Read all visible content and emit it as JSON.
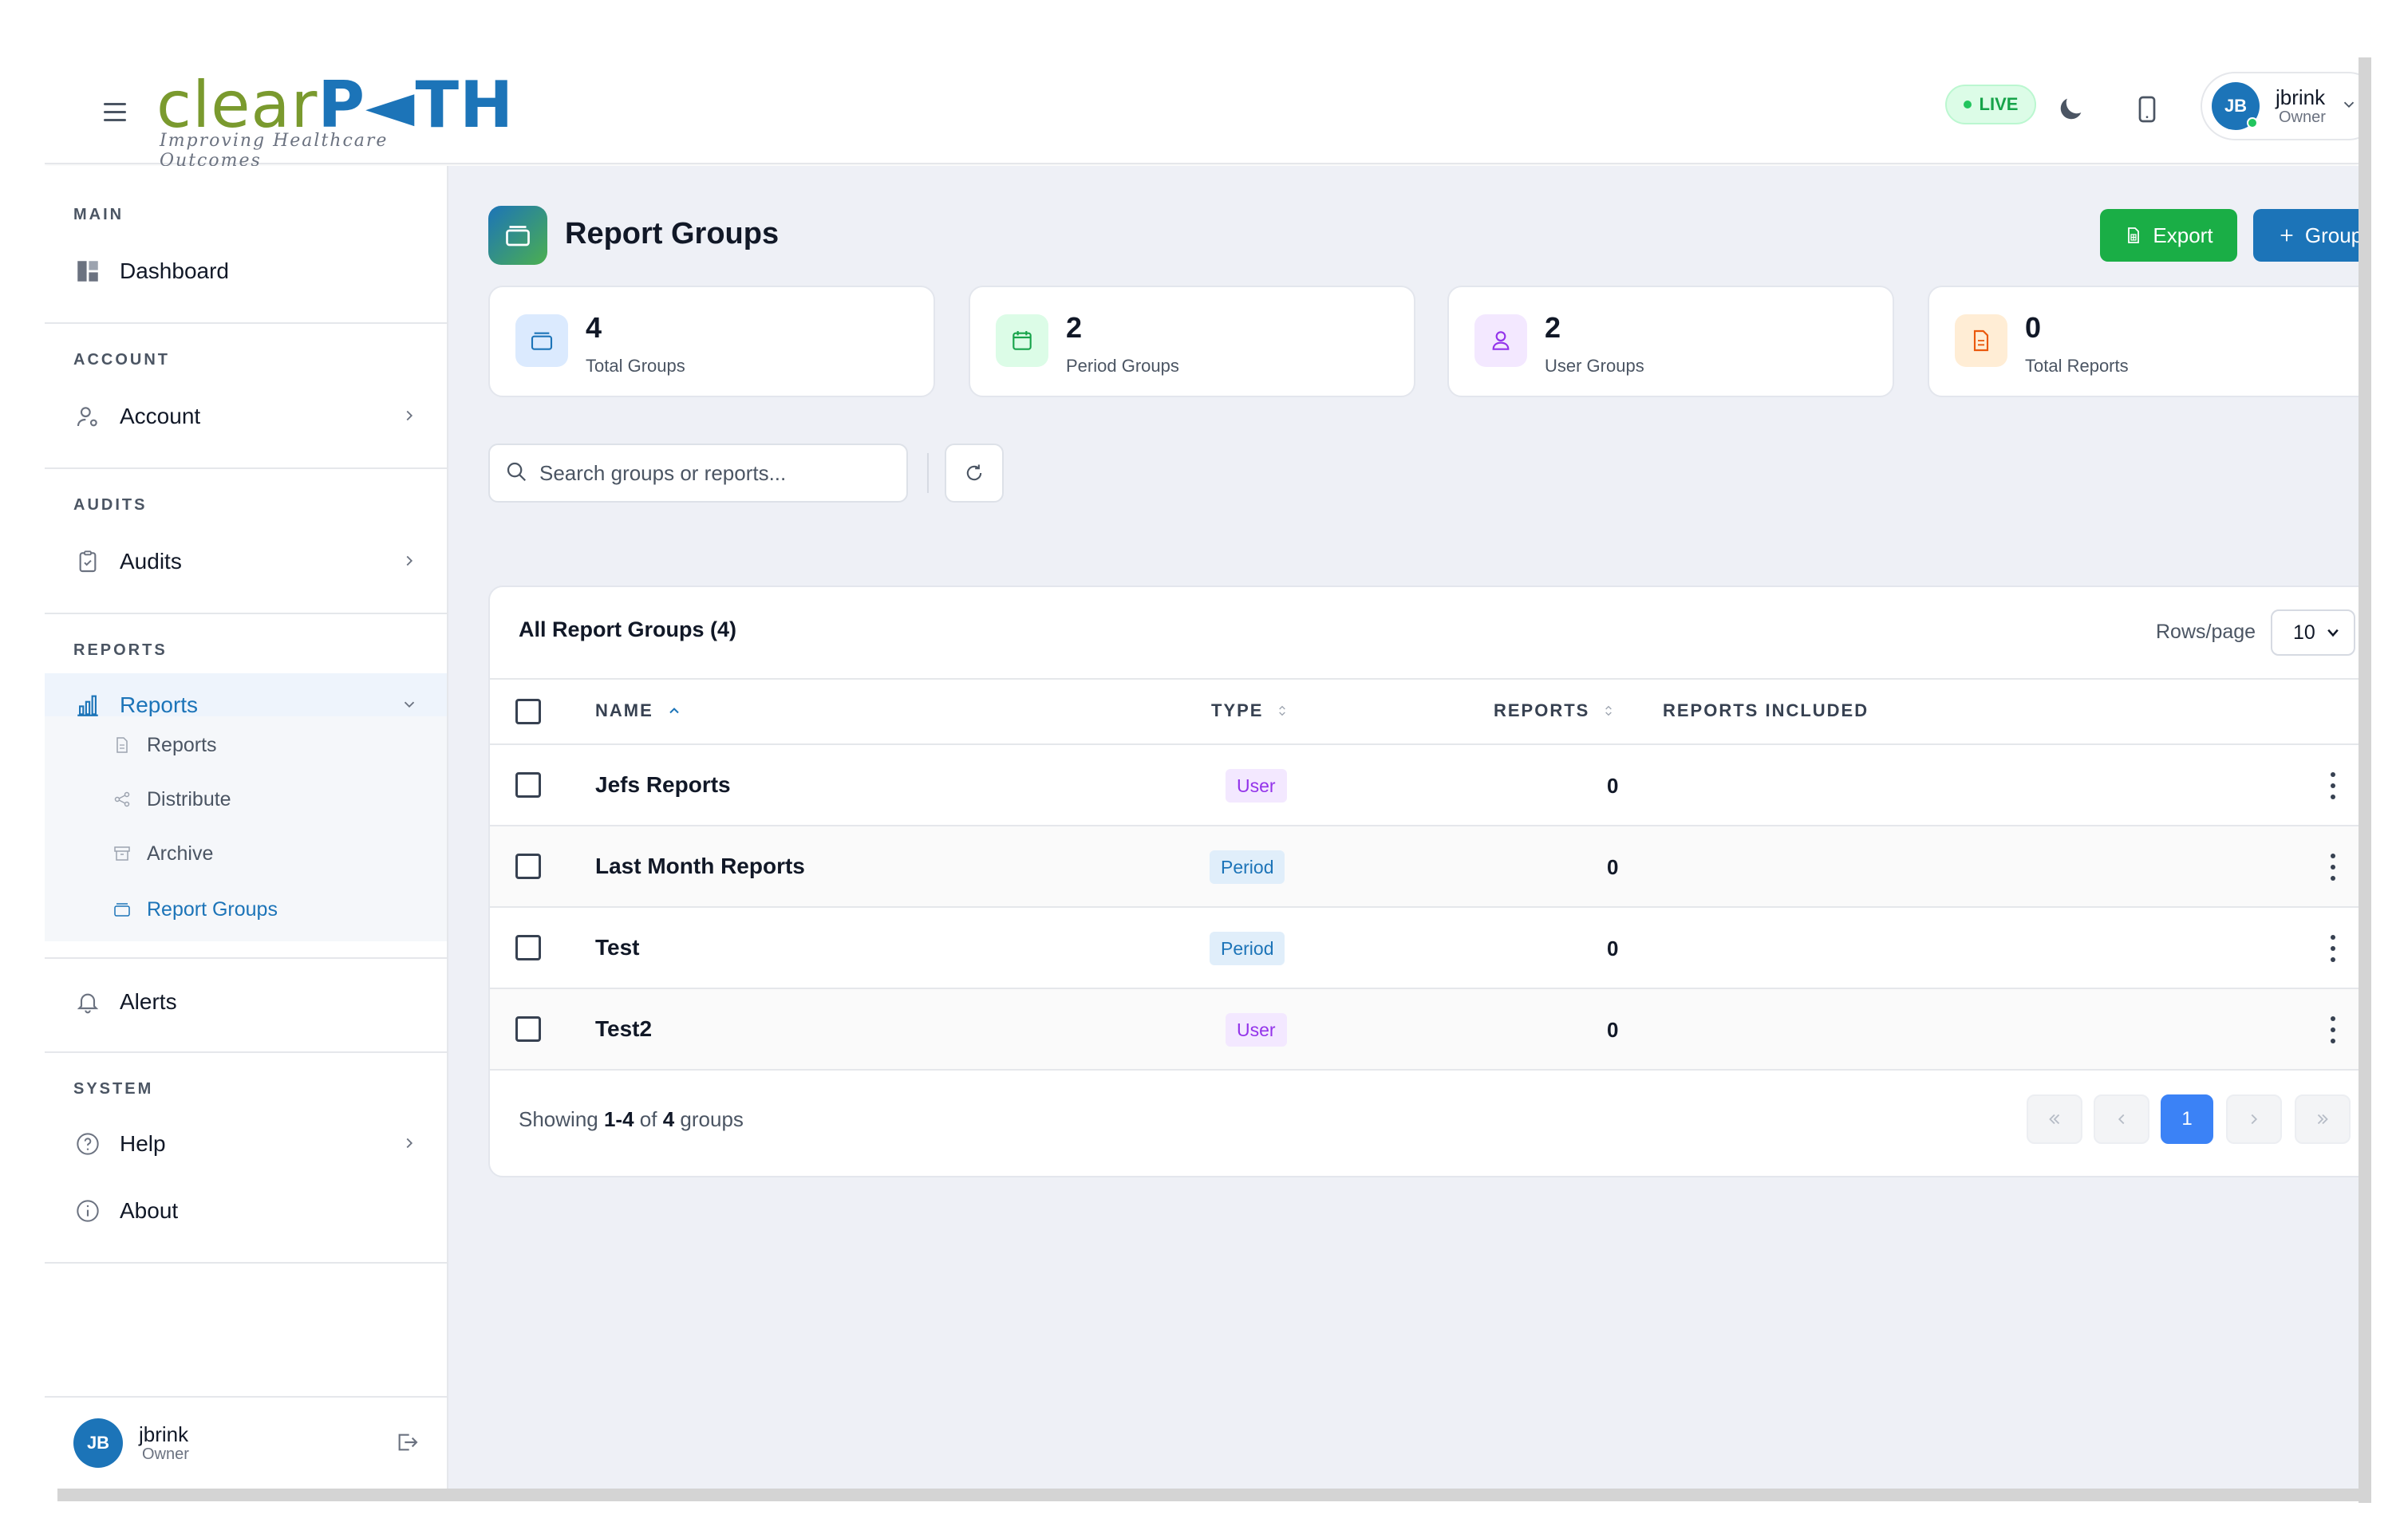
{
  "header": {
    "logo_clear": "clear",
    "logo_path": "P◄TH",
    "logo_tagline": "Improving Healthcare Outcomes",
    "live_label": "LIVE",
    "user": {
      "initials": "JB",
      "name": "jbrink",
      "role": "Owner"
    }
  },
  "sidebar": {
    "sections": {
      "main": "MAIN",
      "account": "ACCOUNT",
      "audits": "AUDITS",
      "reports": "REPORTS",
      "system": "SYSTEM"
    },
    "items": {
      "dashboard": "Dashboard",
      "account": "Account",
      "audits": "Audits",
      "reports": "Reports",
      "alerts": "Alerts",
      "help": "Help",
      "about": "About"
    },
    "reports_sub": [
      "Reports",
      "Distribute",
      "Archive",
      "Report Groups"
    ],
    "user": {
      "initials": "JB",
      "name": "jbrink",
      "role": "Owner"
    }
  },
  "page": {
    "title": "Report Groups",
    "export_label": "Export",
    "group_label": "Group"
  },
  "stats": [
    {
      "value": "4",
      "label": "Total Groups",
      "color": "#1c74b8"
    },
    {
      "value": "2",
      "label": "Period Groups",
      "color": "#16a34a"
    },
    {
      "value": "2",
      "label": "User Groups",
      "color": "#9333ea"
    },
    {
      "value": "0",
      "label": "Total Reports",
      "color": "#ea580c"
    }
  ],
  "search": {
    "placeholder": "Search groups or reports..."
  },
  "table": {
    "title": "All Report Groups (4)",
    "rows_per_page_label": "Rows/page",
    "rows_per_page": "10",
    "columns": [
      "NAME",
      "TYPE",
      "REPORTS",
      "REPORTS INCLUDED"
    ],
    "rows": [
      {
        "name": "Jefs Reports",
        "type": "User",
        "reports": "0",
        "included": ""
      },
      {
        "name": "Last Month Reports",
        "type": "Period",
        "reports": "0",
        "included": ""
      },
      {
        "name": "Test",
        "type": "Period",
        "reports": "0",
        "included": ""
      },
      {
        "name": "Test2",
        "type": "User",
        "reports": "0",
        "included": ""
      }
    ],
    "footer": {
      "prefix": "Showing",
      "range": "1-4",
      "of": "of",
      "total": "4",
      "suffix": "groups"
    },
    "pagination": {
      "current": "1"
    }
  },
  "colors": {
    "brand_blue": "#1c74b8",
    "brand_green": "#7a9a2e",
    "export_green": "#1aae46",
    "page_active": "#3b82f6"
  }
}
